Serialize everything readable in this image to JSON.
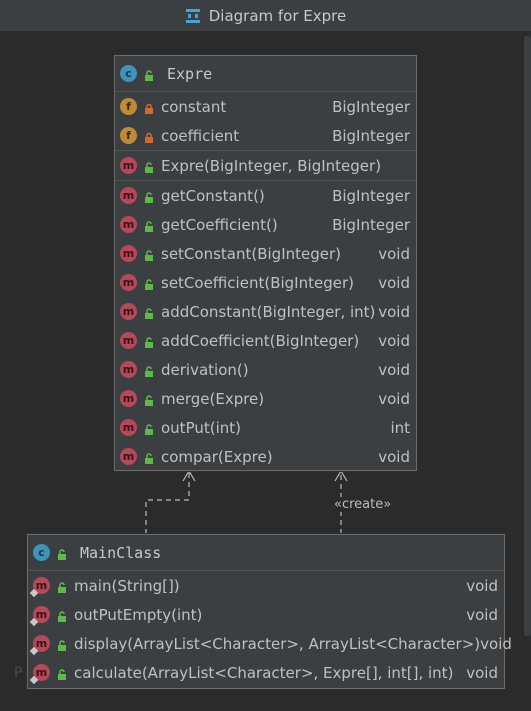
{
  "window": {
    "title": "Diagram for Expre"
  },
  "colors": {
    "background": "#2b2b2b",
    "node": "#3c3f41",
    "class_badge": "#3d93b8",
    "field_badge": "#c08a36",
    "method_badge": "#b5485a",
    "public": "#5fb84a",
    "private": "#d06a30"
  },
  "expre": {
    "badge": "c",
    "name": "Expre",
    "fields": [
      {
        "badge": "f",
        "vis": "private",
        "name": "constant",
        "type": "BigInteger"
      },
      {
        "badge": "f",
        "vis": "private",
        "name": "coefficient",
        "type": "BigInteger"
      }
    ],
    "constructors": [
      {
        "badge": "m",
        "vis": "public",
        "name": "Expre(BigInteger, BigInteger)",
        "type": ""
      }
    ],
    "methods": [
      {
        "badge": "m",
        "vis": "public",
        "name": "getConstant()",
        "type": "BigInteger"
      },
      {
        "badge": "m",
        "vis": "public",
        "name": "getCoefficient()",
        "type": "BigInteger"
      },
      {
        "badge": "m",
        "vis": "public",
        "name": "setConstant(BigInteger)",
        "type": "void"
      },
      {
        "badge": "m",
        "vis": "public",
        "name": "setCoefficient(BigInteger)",
        "type": "void"
      },
      {
        "badge": "m",
        "vis": "public",
        "name": "addConstant(BigInteger, int)",
        "type": "void"
      },
      {
        "badge": "m",
        "vis": "public",
        "name": "addCoefficient(BigInteger)",
        "type": "void"
      },
      {
        "badge": "m",
        "vis": "public",
        "name": "derivation()",
        "type": "void"
      },
      {
        "badge": "m",
        "vis": "public",
        "name": "merge(Expre)",
        "type": "void"
      },
      {
        "badge": "m",
        "vis": "public",
        "name": "outPut(int)",
        "type": "int"
      },
      {
        "badge": "m",
        "vis": "public",
        "name": "compar(Expre)",
        "type": "void"
      }
    ]
  },
  "mainclass": {
    "badge": "c",
    "name": "MainClass",
    "methods": [
      {
        "badge": "m",
        "vis": "public",
        "static": true,
        "name": "main(String[])",
        "type": "void"
      },
      {
        "badge": "m",
        "vis": "public",
        "static": true,
        "name": "outPutEmpty(int)",
        "type": "void"
      },
      {
        "badge": "m",
        "vis": "public",
        "static": true,
        "name": "display(ArrayList<Character>, ArrayList<Character>)",
        "type": "void"
      },
      {
        "badge": "m",
        "vis": "public",
        "static": true,
        "name": "calculate(ArrayList<Character>, Expre[], int[], int)",
        "type": "void"
      }
    ]
  },
  "relations": {
    "create_label": "«create»"
  },
  "watermark": "P"
}
